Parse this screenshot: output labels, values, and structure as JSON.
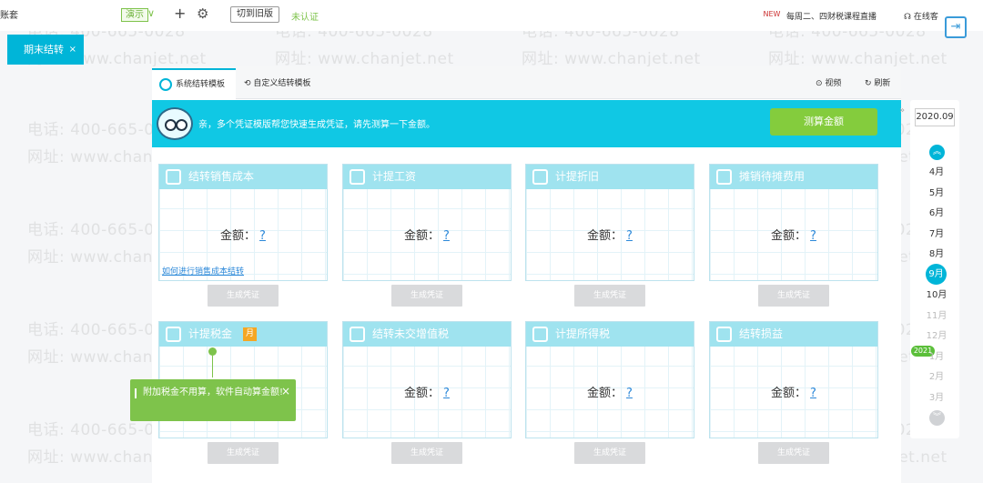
{
  "topbar": {
    "account": "账套",
    "demo_label": "演示",
    "switch_button": "切到旧版",
    "unverified": "未认证",
    "live_badge": "NEW",
    "live_text": "每周二、四财税课程直播",
    "online": "在线客"
  },
  "tabs": {
    "active_label": "期末结转",
    "close": "×"
  },
  "subtabs": {
    "system": "系统结转模板",
    "custom": "自定义结转模板",
    "video": "视频",
    "refresh": "刷新"
  },
  "banner": {
    "text": "亲，多个凭证模版帮您快速生成凭证，请先测算一下金额。",
    "button": "测算金额"
  },
  "cards": [
    {
      "title": "结转销售成本",
      "amount_label": "金额：",
      "amount": "?",
      "help_link": "如何进行销售成本结转",
      "button": "生成凭证"
    },
    {
      "title": "计提工资",
      "amount_label": "金额：",
      "amount": "?",
      "button": "生成凭证"
    },
    {
      "title": "计提折旧",
      "amount_label": "金额：",
      "amount": "?",
      "button": "生成凭证"
    },
    {
      "title": "摊销待摊费用",
      "amount_label": "金额：",
      "amount": "?",
      "button": "生成凭证"
    },
    {
      "title": "计提税金",
      "tag": "月",
      "amount_label": "金额：",
      "amount": "?",
      "button": "生成凭证"
    },
    {
      "title": "结转未交增值税",
      "amount_label": "金额：",
      "amount": "?",
      "button": "生成凭证"
    },
    {
      "title": "计提所得税",
      "amount_label": "金额：",
      "amount": "?",
      "button": "生成凭证"
    },
    {
      "title": "结转损益",
      "amount_label": "金额：",
      "amount": "?",
      "button": "生成凭证"
    }
  ],
  "tooltip": {
    "text": "附加税金不用算，软件自动算金额!",
    "close": "×"
  },
  "timeline": {
    "current": "2020.09",
    "months_2020": [
      "4月",
      "5月",
      "6月",
      "7月",
      "8月",
      "9月",
      "10月",
      "11月",
      "12月"
    ],
    "selected_month": "9月",
    "year_badge": "2021",
    "months_2021": [
      "1月",
      "2月",
      "3月"
    ]
  },
  "watermark": {
    "phone": "电话: 400-665-0028",
    "site": "网址: www.chanjet.net"
  }
}
